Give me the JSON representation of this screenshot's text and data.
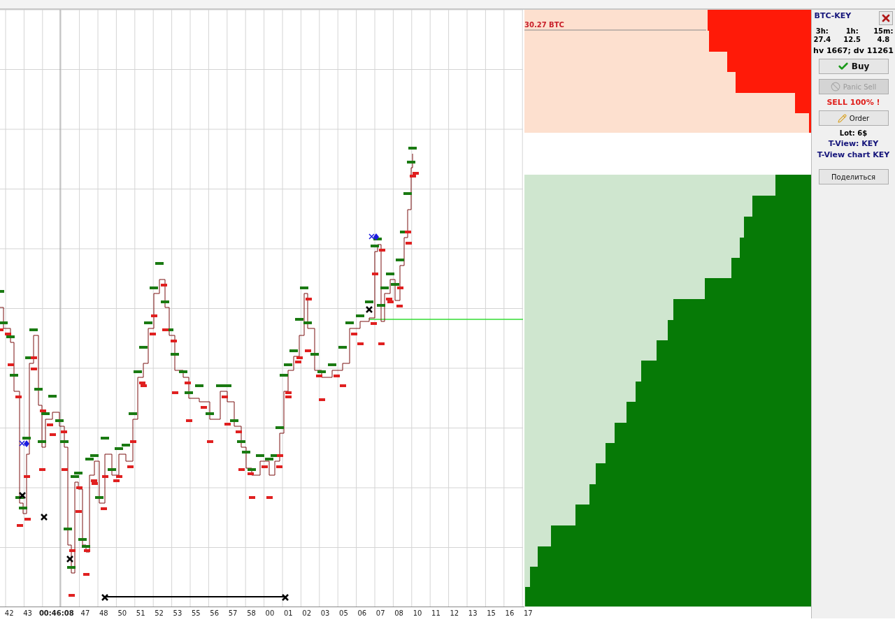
{
  "time_axis": {
    "labels": [
      {
        "text": "42",
        "current": false
      },
      {
        "text": "43",
        "current": false
      },
      {
        "text": "00:46:08",
        "current": true
      },
      {
        "text": "47",
        "current": false
      },
      {
        "text": "48",
        "current": false
      },
      {
        "text": "50",
        "current": false
      },
      {
        "text": "51",
        "current": false
      },
      {
        "text": "52",
        "current": false
      },
      {
        "text": "53",
        "current": false
      },
      {
        "text": "55",
        "current": false
      },
      {
        "text": "56",
        "current": false
      },
      {
        "text": "57",
        "current": false
      },
      {
        "text": "58",
        "current": false
      },
      {
        "text": "00",
        "current": false
      },
      {
        "text": "01",
        "current": false
      },
      {
        "text": "02",
        "current": false
      },
      {
        "text": "03",
        "current": false
      },
      {
        "text": "05",
        "current": false
      },
      {
        "text": "06",
        "current": false
      },
      {
        "text": "07",
        "current": false
      },
      {
        "text": "08",
        "current": false
      },
      {
        "text": "10",
        "current": false
      },
      {
        "text": "11",
        "current": false
      },
      {
        "text": "12",
        "current": false
      },
      {
        "text": "13",
        "current": false
      },
      {
        "text": "15",
        "current": false
      },
      {
        "text": "16",
        "current": false
      },
      {
        "text": "17",
        "current": false
      }
    ]
  },
  "order_book": {
    "ask_volume": "30.27 BTC"
  },
  "side_panel": {
    "pair": "BTC-KEY",
    "stats": [
      {
        "label": "3h:",
        "value": "27.4"
      },
      {
        "label": "1h:",
        "value": "12.5"
      },
      {
        "label": "15m:",
        "value": "4.8"
      }
    ],
    "volumes": "hv 1667; dv 11261",
    "buy_button": {
      "label": "Buy",
      "disabled": false
    },
    "panic_button": {
      "label": "Panic Sell",
      "disabled": true
    },
    "alert": "SELL 100% !",
    "order_button": {
      "label": "Order",
      "disabled": false
    },
    "lot": "Lot: 6$",
    "links": [
      "T-View: KEY",
      "T-View chart KEY"
    ],
    "share_button": {
      "label": "Поделиться",
      "disabled": false
    }
  }
}
